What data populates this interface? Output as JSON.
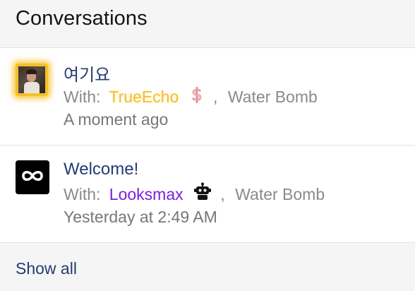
{
  "header": {
    "title": "Conversations"
  },
  "conversations": [
    {
      "title": "여기요",
      "with_label": "With:",
      "participants": [
        {
          "name": "TrueEcho",
          "color": "#f5bc3a",
          "badge_icon": "dollar-sign-icon"
        },
        {
          "name": "Water Bomb",
          "color": "#8a8a8a"
        }
      ],
      "separator": ",",
      "time": "A moment ago",
      "avatar": "user-photo-avatar",
      "avatar_highlight_color": "#f2c02a"
    },
    {
      "title": "Welcome!",
      "with_label": "With:",
      "participants": [
        {
          "name": "Looksmax",
          "color": "#7a20e0",
          "badge_icon": "robot-icon"
        },
        {
          "name": "Water Bomb",
          "color": "#8a8a8a"
        }
      ],
      "separator": ",",
      "time": "Yesterday at 2:49 AM",
      "avatar": "infinity-logo-avatar"
    }
  ],
  "footer": {
    "show_all_label": "Show all"
  },
  "colors": {
    "link": "#243b73",
    "muted": "#8a8a8a",
    "header_bg": "#f5f5f5",
    "divider": "#e3e3e3"
  }
}
